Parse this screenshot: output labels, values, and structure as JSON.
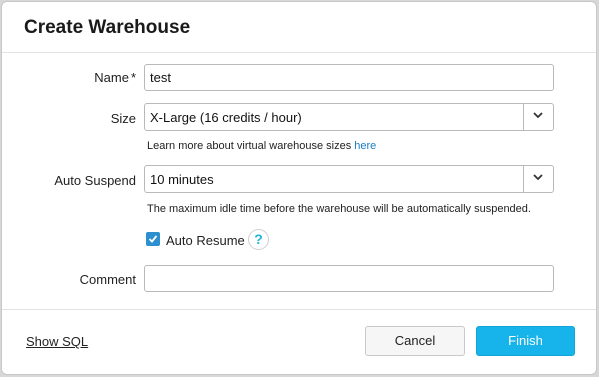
{
  "dialog": {
    "title": "Create Warehouse"
  },
  "form": {
    "name": {
      "label": "Name",
      "required_marker": "*",
      "value": "test"
    },
    "size": {
      "label": "Size",
      "value": "X-Large  (16 credits / hour)",
      "help_text": "Learn more about virtual warehouse sizes ",
      "help_link": "here"
    },
    "auto_suspend": {
      "label": "Auto Suspend",
      "value": "10 minutes",
      "help_text": "The maximum idle time before the warehouse will be automatically suspended."
    },
    "auto_resume": {
      "label": "Auto Resume",
      "checked": true,
      "help_icon": "question-icon",
      "help_glyph": "?"
    },
    "comment": {
      "label": "Comment",
      "value": ""
    }
  },
  "footer": {
    "show_sql": "Show SQL",
    "cancel": "Cancel",
    "finish": "Finish"
  },
  "colors": {
    "accent": "#16b4ea",
    "link": "#1a7fc4",
    "checkbox": "#2b8fd0"
  }
}
